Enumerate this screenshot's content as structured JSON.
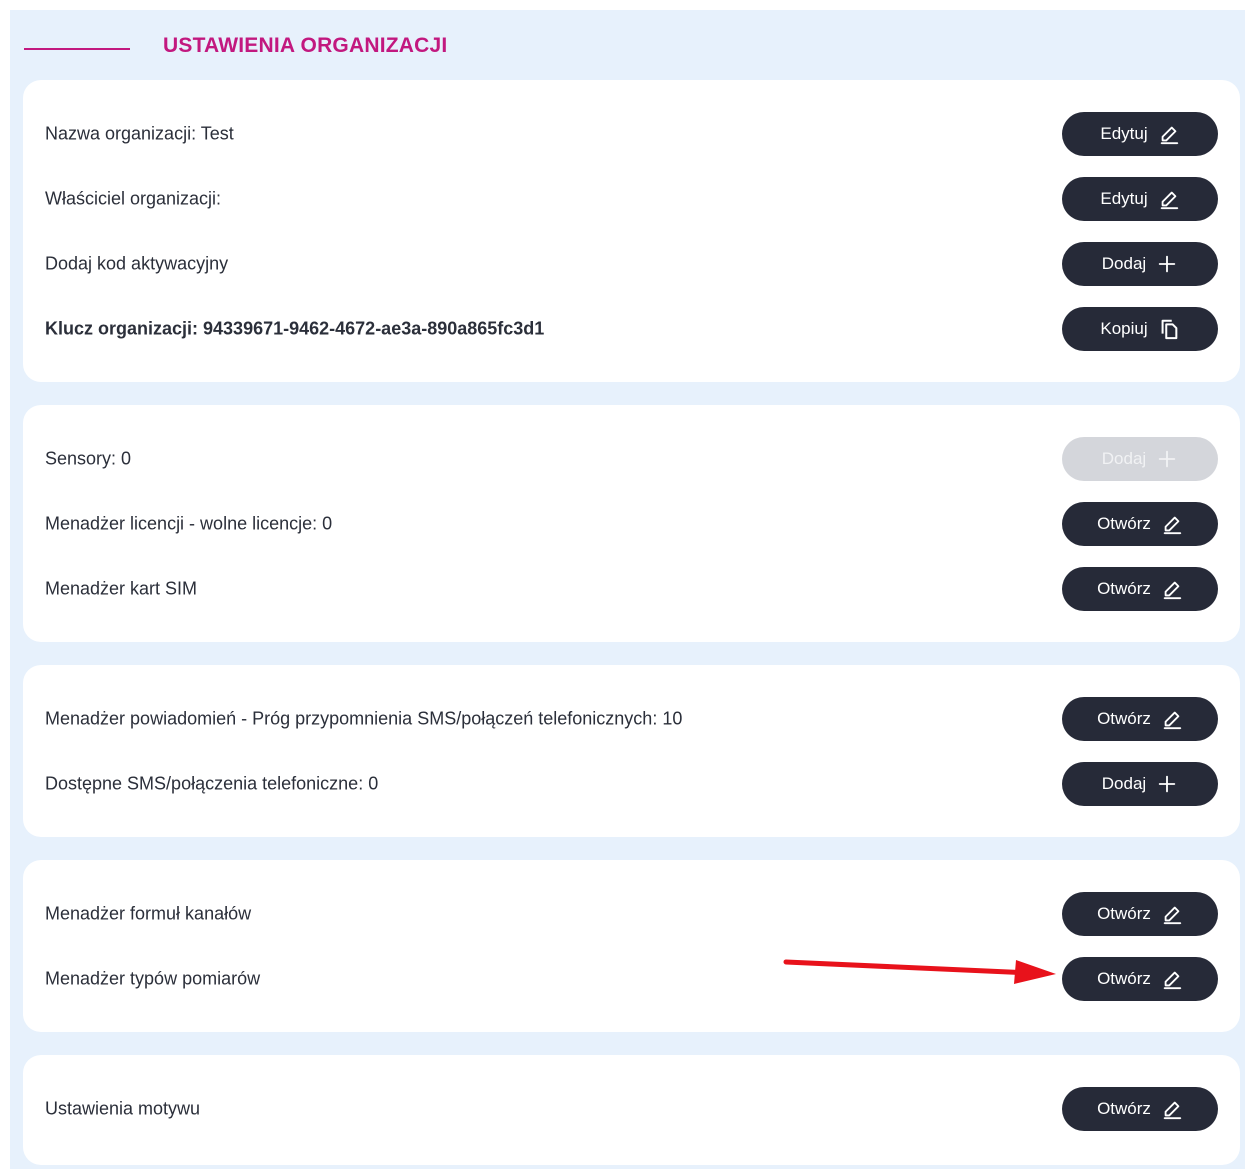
{
  "header": {
    "title": "USTAWIENIA ORGANIZACJI"
  },
  "cards": [
    {
      "rows": [
        {
          "label": "Nazwa organizacji: Test",
          "bold": false,
          "button": {
            "label": "Edytuj",
            "icon": "pencil-icon",
            "disabled": false
          }
        },
        {
          "label": "Właściciel organizacji:",
          "bold": false,
          "button": {
            "label": "Edytuj",
            "icon": "pencil-icon",
            "disabled": false
          }
        },
        {
          "label": "Dodaj kod aktywacyjny",
          "bold": false,
          "button": {
            "label": "Dodaj",
            "icon": "plus-icon",
            "disabled": false
          }
        },
        {
          "label": "Klucz organizacji: 94339671-9462-4672-ae3a-890a865fc3d1",
          "bold": true,
          "button": {
            "label": "Kopiuj",
            "icon": "copy-icon",
            "disabled": false
          }
        }
      ]
    },
    {
      "rows": [
        {
          "label": "Sensory: 0",
          "bold": false,
          "button": {
            "label": "Dodaj",
            "icon": "plus-icon",
            "disabled": true
          }
        },
        {
          "label": "Menadżer licencji - wolne licencje: 0",
          "bold": false,
          "button": {
            "label": "Otwórz",
            "icon": "pencil-icon",
            "disabled": false
          }
        },
        {
          "label": "Menadżer kart SIM",
          "bold": false,
          "button": {
            "label": "Otwórz",
            "icon": "pencil-icon",
            "disabled": false
          }
        }
      ]
    },
    {
      "rows": [
        {
          "label": "Menadżer powiadomień - Próg przypomnienia SMS/połączeń telefonicznych: 10",
          "bold": false,
          "button": {
            "label": "Otwórz",
            "icon": "pencil-icon",
            "disabled": false
          }
        },
        {
          "label": "Dostępne SMS/połączenia telefoniczne: 0",
          "bold": false,
          "button": {
            "label": "Dodaj",
            "icon": "plus-icon",
            "disabled": false
          }
        }
      ]
    },
    {
      "rows": [
        {
          "label": "Menadżer formuł kanałów",
          "bold": false,
          "button": {
            "label": "Otwórz",
            "icon": "pencil-icon",
            "disabled": false
          }
        },
        {
          "label": "Menadżer typów pomiarów",
          "bold": false,
          "button": {
            "label": "Otwórz",
            "icon": "pencil-icon",
            "disabled": false
          }
        }
      ]
    },
    {
      "rows": [
        {
          "label": "Ustawienia motywu",
          "bold": false,
          "button": {
            "label": "Otwórz",
            "icon": "pencil-icon",
            "disabled": false
          }
        }
      ]
    }
  ],
  "colors": {
    "accent": "#c2187f",
    "panel_bg": "#e7f1fc",
    "button_bg": "#262a38",
    "button_disabled_bg": "#d4d6db",
    "annotation_arrow": "#e8121b"
  }
}
